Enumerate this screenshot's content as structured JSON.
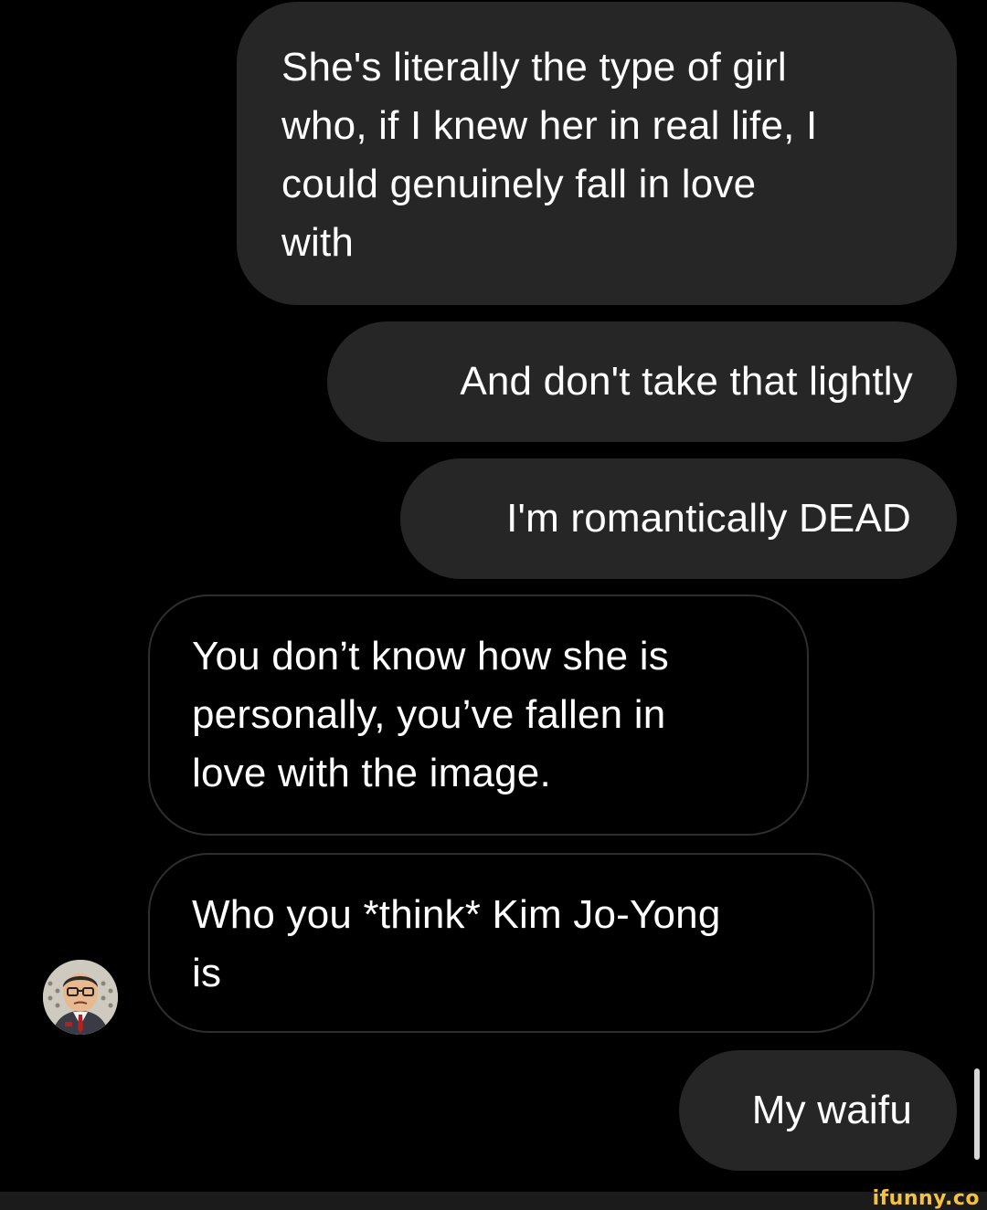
{
  "conversation": {
    "messages": [
      {
        "direction": "sent",
        "text": "She's literally the type of girl\nwho, if I knew her in real life, I\ncould genuinely fall in love\nwith"
      },
      {
        "direction": "sent",
        "text": "And don't take that lightly"
      },
      {
        "direction": "sent",
        "text": "I'm romantically DEAD"
      },
      {
        "direction": "received",
        "text": "You don’t know how she is\npersonally, you’ve fallen in\nlove with the image."
      },
      {
        "direction": "received",
        "text": "Who you *think* Kim Jo-Yong\nis"
      },
      {
        "direction": "sent",
        "text": "My waifu"
      }
    ]
  },
  "contact": {
    "avatar_icon": "cartoon-avatar-icon"
  },
  "watermark": {
    "text": "ifunny.co"
  },
  "colors": {
    "background": "#000000",
    "sent_bubble": "#262626",
    "received_border": "#2e2e2e",
    "text": "#ffffff",
    "watermark": "#f6c23e"
  }
}
